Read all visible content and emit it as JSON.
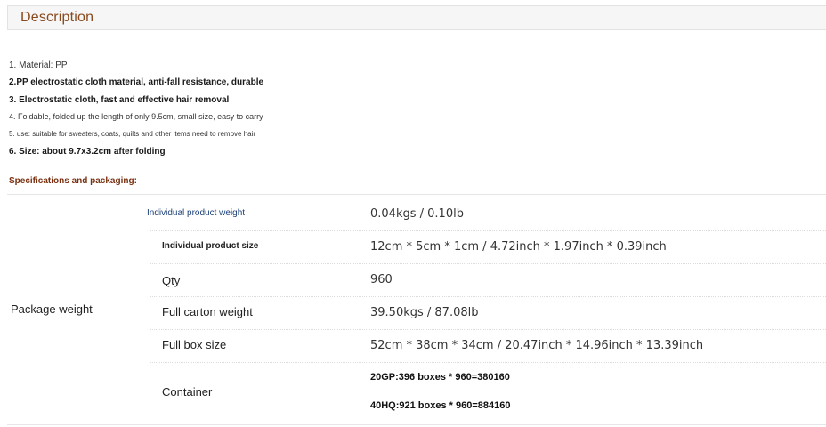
{
  "description": {
    "title": "Description",
    "lines": [
      "1. Material: PP",
      "2.PP electrostatic cloth material, anti-fall resistance, durable",
      "3. Electrostatic cloth, fast and effective hair removal",
      "4. Foldable, folded up the length of only 9.5cm, small size, easy to carry",
      "5. use: suitable for sweaters, coats, quilts and other items need to remove hair",
      "6. Size: about 9.7x3.2cm after folding"
    ]
  },
  "specifications": {
    "heading": "Specifications and packaging:",
    "group_label": "Package weight",
    "rows": [
      {
        "label": "Individual product weight",
        "value": "0.04kgs / 0.10lb"
      },
      {
        "label": "Individual product size",
        "value": "12cm * 5cm * 1cm / 4.72inch * 1.97inch * 0.39inch"
      },
      {
        "label": "Qty",
        "value": "960"
      },
      {
        "label": "Full carton weight",
        "value": "39.50kgs / 87.08lb"
      },
      {
        "label": "Full box size",
        "value": "52cm * 38cm * 34cm / 20.47inch * 14.96inch * 13.39inch"
      },
      {
        "label": "Container",
        "values": [
          "20GP:396 boxes * 960=380160",
          "40HQ:921 boxes * 960=884160"
        ]
      }
    ]
  }
}
